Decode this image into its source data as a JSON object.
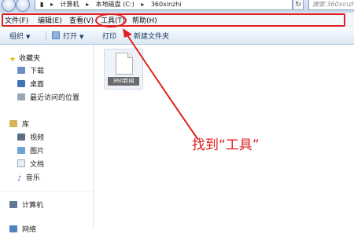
{
  "address": {
    "path": [
      "计算机",
      "本地磁盘 (C:)",
      "360xinzhi"
    ],
    "separator": "▸",
    "refresh_glyph": "↻",
    "search_placeholder": "搜索 360xinzhi"
  },
  "menu": [
    {
      "label": "文件(F)"
    },
    {
      "label": "编辑(E)"
    },
    {
      "label": "查看(V)"
    },
    {
      "label": "工具(T)"
    },
    {
      "label": "帮助(H)"
    }
  ],
  "toolbar": {
    "organize": "组织",
    "open": "打开",
    "print": "打印",
    "new_folder": "新建文件夹"
  },
  "sidebar": {
    "favorites": "收藏夹",
    "favorites_items": [
      "下载",
      "桌面",
      "最近访问的位置"
    ],
    "libraries": "库",
    "libraries_items": [
      "视频",
      "图片",
      "文档",
      "音乐"
    ],
    "computer": "计算机",
    "network": "网络"
  },
  "content": {
    "file_name": "360新闻"
  },
  "annotation": {
    "text": "找到“工具”",
    "color": "#e02020"
  }
}
